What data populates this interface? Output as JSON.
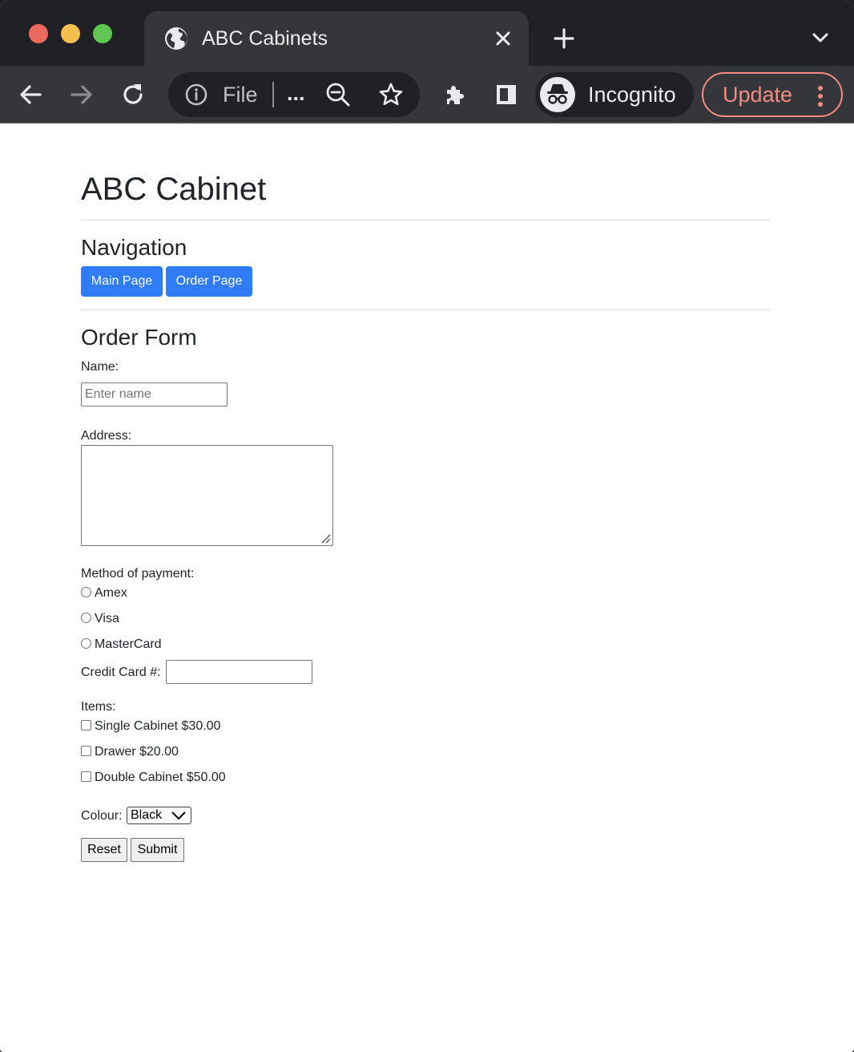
{
  "browser": {
    "tab": {
      "title": "ABC Cabinets",
      "favicon": "globe-icon",
      "close_icon": "close-icon"
    },
    "new_tab_icon": "plus-icon",
    "tab_search_icon": "chevron-down-icon",
    "toolbar": {
      "back_icon": "arrow-left-icon",
      "forward_icon": "arrow-right-icon",
      "reload_icon": "reload-icon",
      "omnibox": {
        "info_icon": "info-icon",
        "text": "File",
        "ellipsis": "...",
        "zoom_icon": "zoom-out-icon",
        "bookmark_icon": "star-icon"
      },
      "extensions_icon": "puzzle-icon",
      "side_panel_icon": "side-panel-icon",
      "profile": {
        "label": "Incognito",
        "icon": "incognito-icon"
      },
      "update": {
        "label": "Update",
        "menu_icon": "kebab-menu-icon"
      }
    },
    "colors": {
      "frame": "#202124",
      "toolbar": "#35363a",
      "update_accent": "#f28b82",
      "traffic_red": "#ed6a5e",
      "traffic_yellow": "#f4bf4f",
      "traffic_green": "#61c554"
    }
  },
  "page": {
    "title": "ABC Cabinet",
    "navigation": {
      "heading": "Navigation",
      "buttons": [
        {
          "label": "Main Page"
        },
        {
          "label": "Order Page"
        }
      ],
      "button_color": "#2f7cf6"
    },
    "order_form": {
      "heading": "Order Form",
      "name": {
        "label": "Name:",
        "placeholder": "Enter name",
        "value": ""
      },
      "address": {
        "label": "Address:",
        "value": ""
      },
      "payment": {
        "label": "Method of payment:",
        "options": [
          {
            "label": "Amex",
            "selected": false
          },
          {
            "label": "Visa",
            "selected": false
          },
          {
            "label": "MasterCard",
            "selected": false
          }
        ]
      },
      "credit_card": {
        "label": "Credit Card #:",
        "value": ""
      },
      "items": {
        "label": "Items:",
        "options": [
          {
            "label": "Single Cabinet $30.00",
            "checked": false
          },
          {
            "label": "Drawer $20.00",
            "checked": false
          },
          {
            "label": "Double Cabinet $50.00",
            "checked": false
          }
        ]
      },
      "colour": {
        "label": "Colour:",
        "selected": "Black"
      },
      "reset_label": "Reset",
      "submit_label": "Submit"
    }
  }
}
